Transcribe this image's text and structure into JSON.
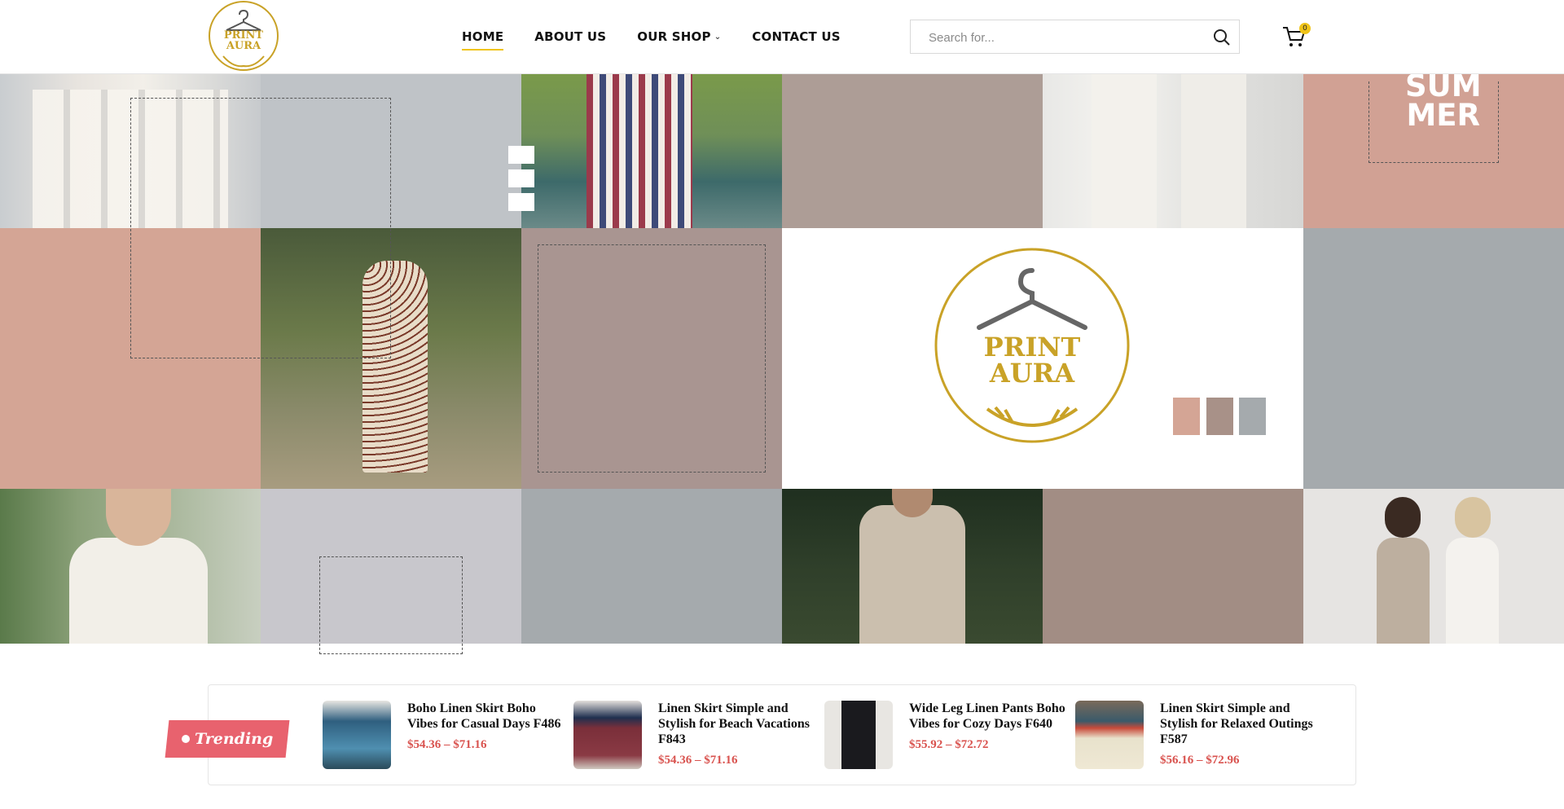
{
  "brand": {
    "logo_text_line1": "PRINT",
    "logo_text_line2": "AURA",
    "gold": "#c9a227"
  },
  "nav": {
    "items": [
      {
        "label": "HOME",
        "active": true
      },
      {
        "label": "ABOUT US",
        "active": false
      },
      {
        "label": "OUR SHOP",
        "active": false,
        "has_dropdown": true
      },
      {
        "label": "CONTACT US",
        "active": false
      }
    ]
  },
  "search": {
    "placeholder": "Search for..."
  },
  "cart": {
    "count": "0"
  },
  "hero": {
    "summer_line1": "SUM",
    "summer_line2": "MER",
    "center_logo_line1": "PRINT",
    "center_logo_line2": "AURA",
    "palette": [
      "#d4a595",
      "#a89188",
      "#a5aaad"
    ]
  },
  "trending": {
    "badge_label": "Trending",
    "products": [
      {
        "name": "Boho Linen Skirt Boho Vibes for Casual Days F486",
        "price": "$54.36 – $71.16"
      },
      {
        "name": "Linen Skirt Simple and Stylish for Beach Vacations F843",
        "price": "$54.36 – $71.16"
      },
      {
        "name": "Wide Leg Linen Pants Boho Vibes for Cozy Days F640",
        "price": "$55.92 – $72.72"
      },
      {
        "name": "Linen Skirt Simple and Stylish for Relaxed Outings F587",
        "price": "$56.16 – $72.96"
      }
    ],
    "price_color": "#d9534f",
    "badge_color": "#e8626e"
  }
}
